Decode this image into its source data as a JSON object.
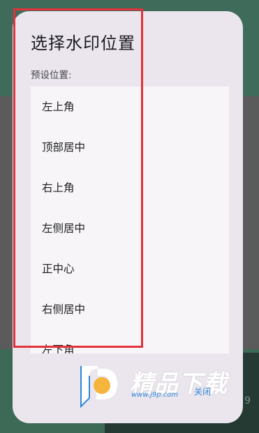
{
  "dialog": {
    "title": "选择水印位置",
    "subtitle": "预设位置:",
    "options": [
      {
        "label": "左上角"
      },
      {
        "label": "顶部居中"
      },
      {
        "label": "右上角"
      },
      {
        "label": "左侧居中"
      },
      {
        "label": "正中心"
      },
      {
        "label": "右侧居中"
      },
      {
        "label": "左下角"
      }
    ]
  },
  "watermark": {
    "brand": "精品下载",
    "url": "www.j9p.com",
    "close_label": "关闭",
    "brand_color": "#2f86d9",
    "logo_accent": "#f5b43c"
  },
  "background": {
    "side_number": "9"
  },
  "colors": {
    "highlight": "#e2323a",
    "dialog_bg": "#ebe6ee",
    "list_bg": "#f7f5f8"
  }
}
